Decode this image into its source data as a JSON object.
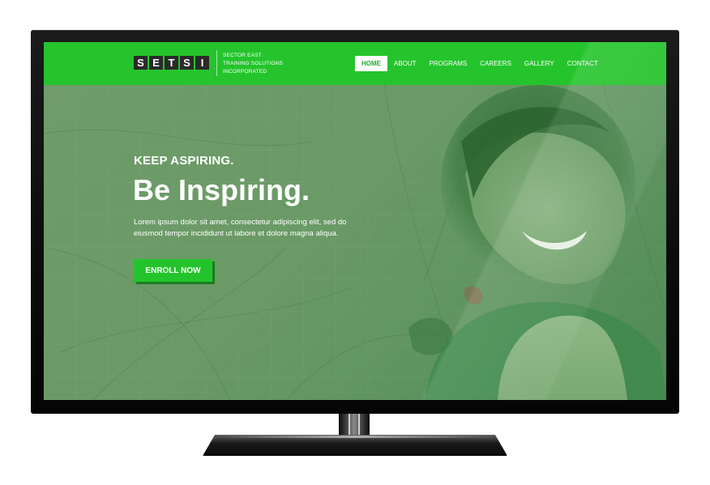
{
  "header": {
    "logo_letters": [
      "S",
      "E",
      "T",
      "S",
      "I"
    ],
    "tagline_lines": [
      "SECTOR EAST",
      "TRAINING SOLUTIONS",
      "INCORPORATED"
    ]
  },
  "nav": {
    "items": [
      {
        "label": "HOME",
        "active": true
      },
      {
        "label": "ABOUT",
        "active": false
      },
      {
        "label": "PROGRAMS",
        "active": false
      },
      {
        "label": "CAREERS",
        "active": false
      },
      {
        "label": "GALLERY",
        "active": false
      },
      {
        "label": "CONTACT",
        "active": false
      }
    ]
  },
  "hero": {
    "kicker": "KEEP ASPIRING.",
    "title": "Be Inspiring.",
    "description": "Lorem ipsum dolor sit amet, consectetur adipiscing elit, sed do eiusmod tempor incididunt ut labore et dolore magna aliqua.",
    "cta_label": "ENROLL NOW"
  },
  "colors": {
    "brand_green": "#25c42c",
    "hero_overlay": "#6f9e6a",
    "logo_tile": "#2a2a2a",
    "monitor_bezel": "#111111"
  }
}
